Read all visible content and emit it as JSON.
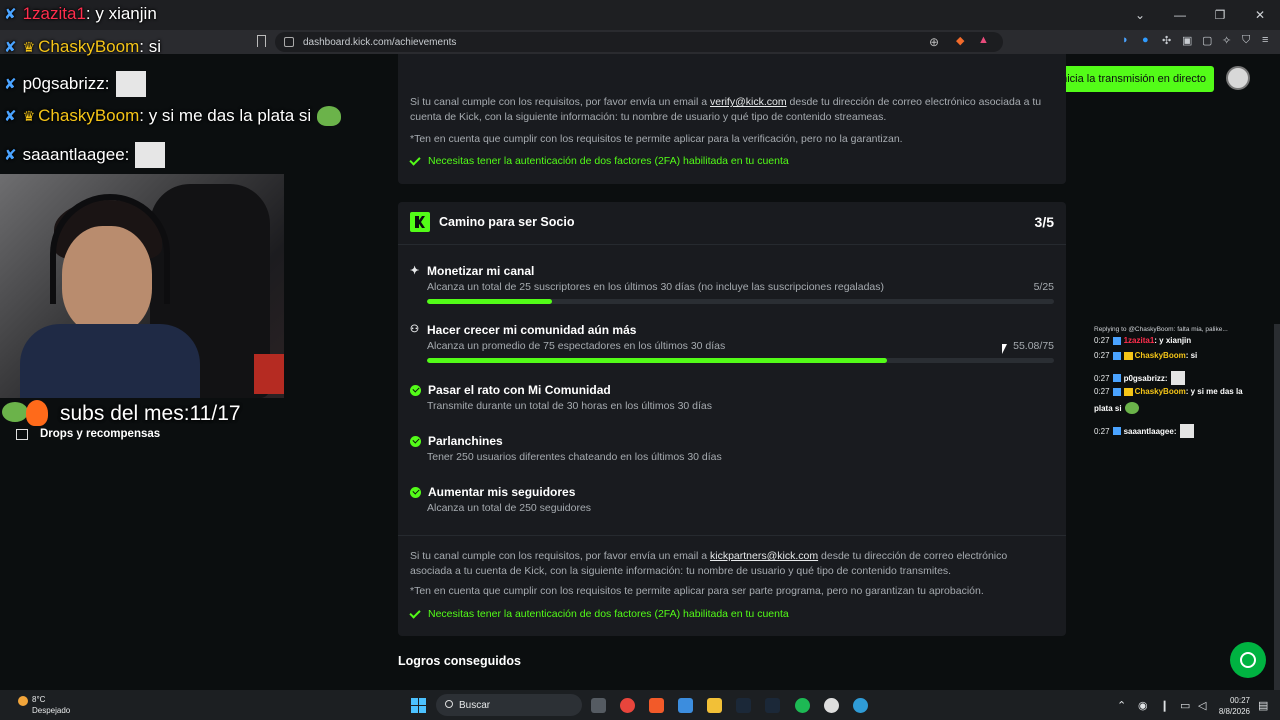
{
  "browser": {
    "url": "dashboard.kick.com/achievements"
  },
  "overlay": {
    "chat": [
      {
        "name": "1zazita1",
        "text": ": y xianjin",
        "name_color": "#ff2e4d"
      },
      {
        "name": "ChaskyBoom",
        "text": ": si",
        "name_color": "#f5c518"
      },
      {
        "name": "p0gsabrizz",
        "text": ":",
        "name_color": "#ffffff"
      },
      {
        "name": "ChaskyBoom",
        "text": ": y si me das la plata si",
        "name_color": "#f5c518"
      },
      {
        "name": "saaantlaagee",
        "text": ":",
        "name_color": "#ffffff"
      }
    ],
    "subs_text": "subs del mes:11/17"
  },
  "sidebar": {
    "drops_label": "Drops y recompensas"
  },
  "header": {
    "stream_button": "Inicia la transmisión en directo"
  },
  "card1": {
    "text_a": "Si tu canal cumple con los requisitos, por favor envía un email a",
    "email": "verify@kick.com",
    "text_b": "desde tu dirección de correo electrónico asociada a tu cuenta de Kick, con la siguiente información: tu nombre de usuario y qué tipo de contenido streameas.",
    "note": "*Ten en cuenta que cumplir con los requisitos te permite aplicar para la verificación, pero no la garantizan.",
    "twofa": "Necesitas tener la autenticación de dos factores (2FA) habilitada en tu cuenta"
  },
  "card2": {
    "title": "Camino para ser Socio",
    "count": "3/5",
    "requirements": [
      {
        "title": "Monetizar mi canal",
        "desc": "Alcanza un total de 25 suscriptores en los últimos 30 días (no incluye las suscripciones regaladas)",
        "progress_text": "5/25",
        "progress": 0.2,
        "state": "in-progress",
        "icon": "sparkle-icon"
      },
      {
        "title": "Hacer crecer mi comunidad aún más",
        "desc": "Alcanza un promedio de 75 espectadores en los últimos 30 días",
        "progress_text": "55.08/75",
        "progress": 0.734,
        "state": "in-progress",
        "icon": "people-icon"
      },
      {
        "title": "Pasar el rato con Mi Comunidad",
        "desc": "Transmite durante un total de 30 horas en los últimos 30 días",
        "state": "done",
        "icon": "check-circle-icon"
      },
      {
        "title": "Parlanchines",
        "desc": "Tener 250 usuarios diferentes chateando en los últimos 30 días",
        "state": "done",
        "icon": "check-circle-icon"
      },
      {
        "title": "Aumentar mis seguidores",
        "desc": "Alcanza un total de 250 seguidores",
        "state": "done",
        "icon": "check-circle-icon"
      }
    ],
    "text_a": "Si tu canal cumple con los requisitos, por favor envía un email a",
    "email": "kickpartners@kick.com",
    "text_b": "desde tu dirección de correo electrónico asociada a tu cuenta de Kick, con la siguiente información: tu nombre de usuario y qué tipo de contenido transmites.",
    "note": "*Ten en cuenta que cumplir con los requisitos te permite aplicar para ser parte programa, pero no garantizan tu aprobación.",
    "twofa": "Necesitas tener la autenticación de dos factores (2FA) habilitada en tu cuenta"
  },
  "achievements_title": "Logros conseguidos",
  "mini_chat": {
    "reply_label": "Replying to @ChaskyBoom: falta mia, palike...",
    "lines": [
      {
        "time": "0:27",
        "name": "1zazita1",
        "text": ": y xianjin"
      },
      {
        "time": "0:27",
        "name": "ChaskyBoom",
        "text": ": si"
      },
      {
        "time": "0:27",
        "name": "p0gsabrizz",
        "text": ":"
      },
      {
        "time": "0:27",
        "name": "ChaskyBoom",
        "text": ": y si me das la"
      },
      {
        "time": "",
        "name": "",
        "text": "plata si"
      },
      {
        "time": "0:27",
        "name": "saaantlaagee",
        "text": ":"
      }
    ]
  },
  "taskbar": {
    "weather_temp": "8°C",
    "weather_desc": "Despejado",
    "search_label": "Buscar",
    "time": "00:27",
    "date": "8/8/2026"
  },
  "colors": {
    "accent": "#53fc18",
    "background": "#0b0e0f",
    "card": "#191b1f"
  }
}
